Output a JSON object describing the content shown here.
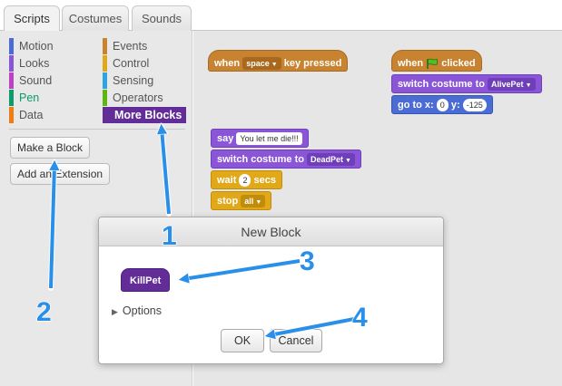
{
  "tabs": [
    {
      "label": "Scripts",
      "active": true
    },
    {
      "label": "Costumes",
      "active": false
    },
    {
      "label": "Sounds",
      "active": false
    }
  ],
  "palette": {
    "categories": [
      {
        "label": "Motion",
        "color": "#4a6cd4"
      },
      {
        "label": "Looks",
        "color": "#8a55d7"
      },
      {
        "label": "Sound",
        "color": "#bb42c3"
      },
      {
        "label": "Pen",
        "color": "#0e9a6c"
      },
      {
        "label": "Data",
        "color": "#ee7d16"
      },
      {
        "label": "Events",
        "color": "#c88330"
      },
      {
        "label": "Control",
        "color": "#e1a91a"
      },
      {
        "label": "Sensing",
        "color": "#2ca5e2"
      },
      {
        "label": "Operators",
        "color": "#5cb712"
      },
      {
        "label": "More Blocks",
        "color": "#632d99"
      }
    ],
    "make_block": "Make a Block",
    "add_extension": "Add an Extension"
  },
  "scripts": {
    "s1": {
      "when": "when",
      "key": "space",
      "pressed": "key pressed"
    },
    "s2": {
      "when": "when",
      "clicked": "clicked",
      "switch": "switch costume to",
      "costume": "AlivePet",
      "goto": "go to x:",
      "x": "0",
      "y_label": "y:",
      "y": "-125"
    },
    "s3": {
      "say": "say",
      "say_text": "You let me die!!!",
      "switch": "switch costume to",
      "costume": "DeadPet",
      "wait": "wait",
      "wait_num": "2",
      "secs": "secs",
      "stop": "stop",
      "stop_opt": "all"
    }
  },
  "dialog": {
    "title": "New Block",
    "block_name": "KillPet",
    "options": "Options",
    "ok": "OK",
    "cancel": "Cancel"
  },
  "annotations": [
    "1",
    "2",
    "3",
    "4"
  ],
  "colors": {
    "arrow": "#2a8fe8",
    "arrow_outline": "#ffffff"
  }
}
